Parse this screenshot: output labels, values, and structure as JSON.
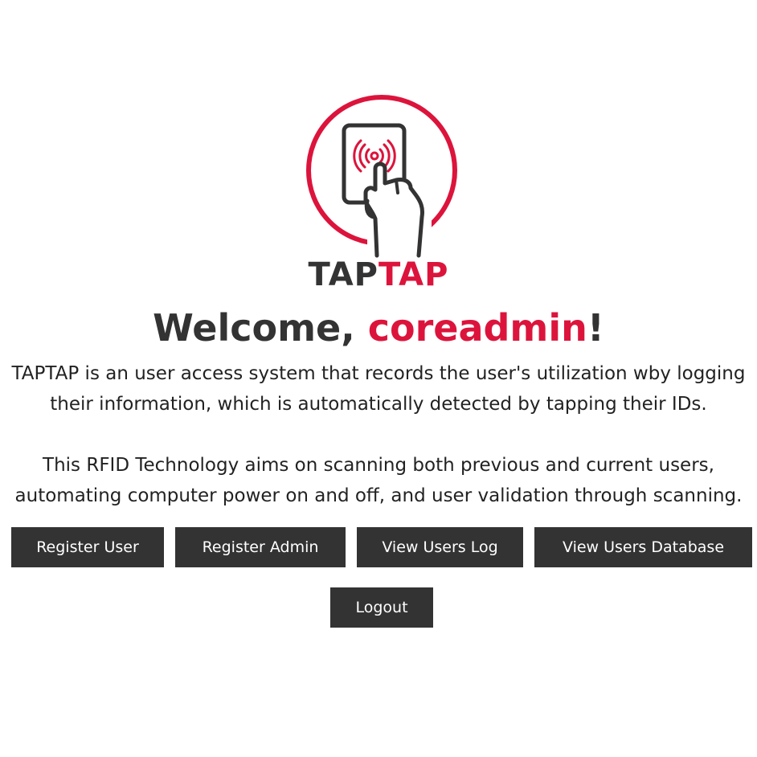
{
  "brand": {
    "part1": "TAP",
    "part2": "TAP"
  },
  "welcome": {
    "prefix": "Welcome, ",
    "username": "coreadmin",
    "suffix": "!"
  },
  "description": {
    "paragraph1": [
      "TAPTAP is an user access system that records the user's utilization wby logging",
      "their information, which is automatically detected by tapping their IDs."
    ],
    "paragraph2": [
      "This RFID Technology aims on scanning both previous and current users,",
      "automating computer power on and off, and user validation through scanning."
    ]
  },
  "buttons": {
    "register_user": "Register User",
    "register_admin": "Register Admin",
    "view_users_log": "View Users Log",
    "view_users_database": "View Users Database",
    "logout": "Logout"
  },
  "colors": {
    "accent": "#dc143c",
    "dark": "#333333",
    "background": "#ffffff"
  },
  "icons": {
    "logo": "hand-tapping-rfid-card-icon"
  }
}
